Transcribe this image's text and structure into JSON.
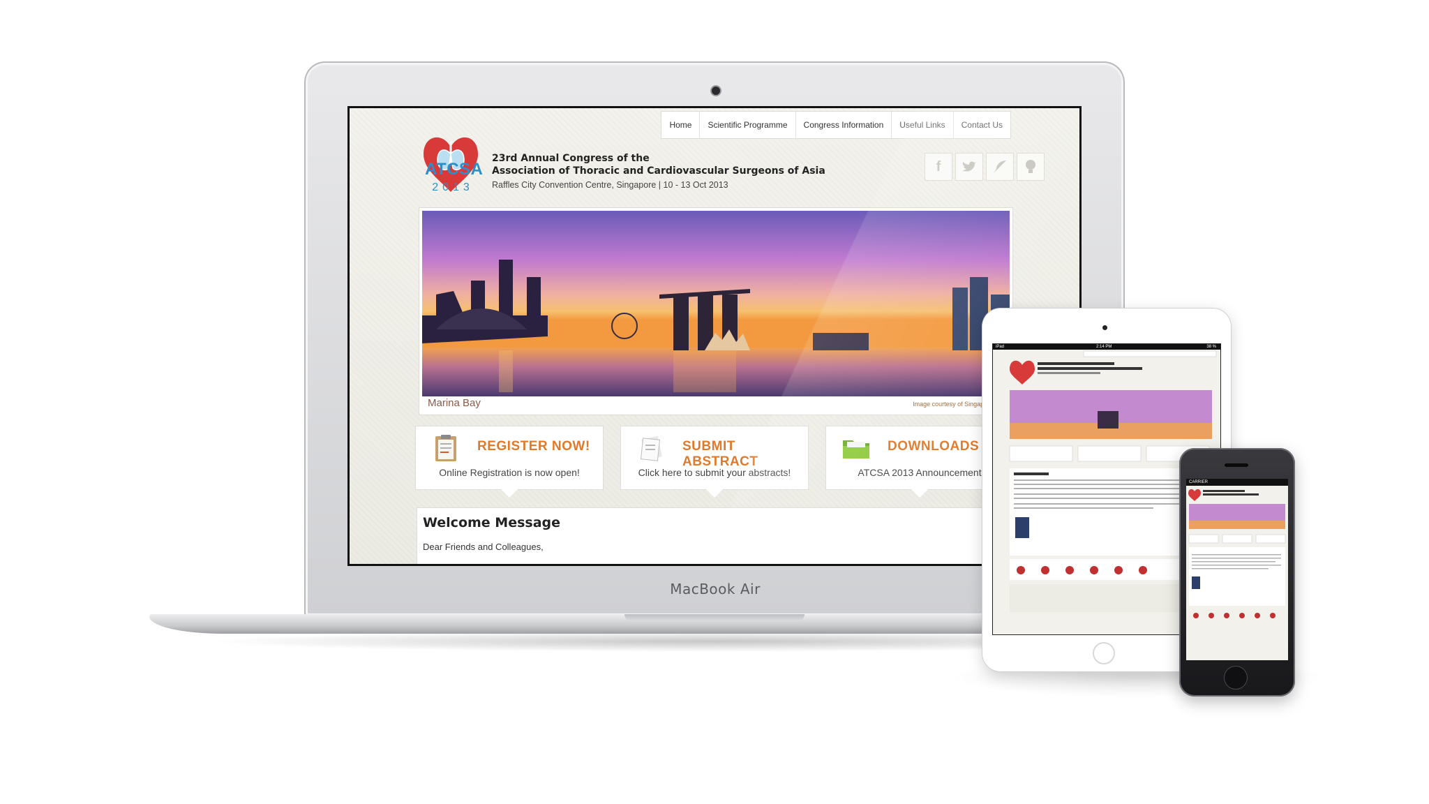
{
  "device": {
    "laptop_label": "MacBook Air",
    "tablet_status_left": "iPad",
    "tablet_status_time": "2:14 PM",
    "tablet_status_right": "38 %",
    "phone_carrier": "CARRIER"
  },
  "nav": {
    "items": [
      "Home",
      "Scientific Programme",
      "Congress Information",
      "Useful Links",
      "Contact Us"
    ]
  },
  "header": {
    "logo_text": "ATCSA",
    "logo_year": "2013",
    "title_line1": "23rd Annual Congress of the",
    "title_line2": "Association of  Thoracic and Cardiovascular Surgeons of Asia",
    "venue": "Raffles City Convention Centre, Singapore  |  10 - 13 Oct 2013"
  },
  "social": {
    "icons": [
      "facebook-icon",
      "twitter-icon",
      "feather-icon",
      "lightbulb-icon"
    ]
  },
  "banner": {
    "caption": "Marina Bay",
    "credit": "Image courtesy of Singapore Tour"
  },
  "cards": [
    {
      "title": "REGISTER NOW!",
      "subtitle": "Online Registration is now open!",
      "icon": "clipboard-icon"
    },
    {
      "title": "SUBMIT ABSTRACT",
      "subtitle": "Click here to submit your abstracts!",
      "icon": "documents-icon"
    },
    {
      "title": "DOWNLOADS",
      "subtitle": "ATCSA 2013 Announcement",
      "icon": "folder-icon"
    }
  ],
  "welcome": {
    "title": "Welcome Message",
    "greeting": "Dear Friends and Colleagues,"
  },
  "colors": {
    "accent_orange": "#e07a2b",
    "logo_blue": "#2b8fc9",
    "logo_red": "#d83a3a"
  }
}
